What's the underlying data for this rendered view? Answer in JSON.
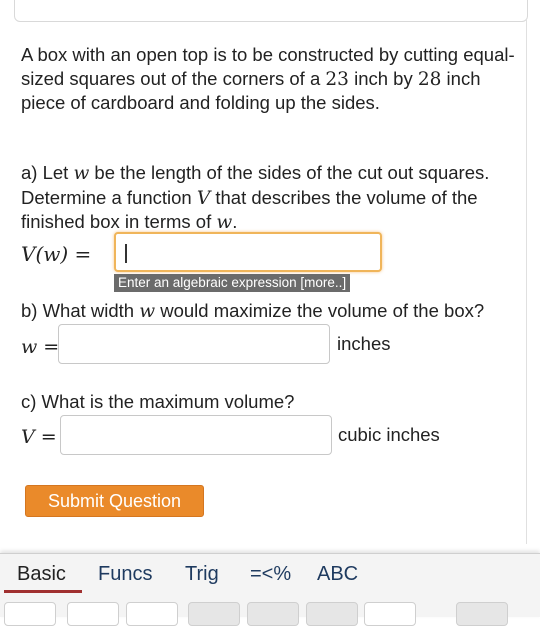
{
  "problem": {
    "intro_text": "A box with an open top is to be constructed by cutting equal-sized squares out of the corners of a ",
    "dim1": "23",
    "intro_mid": " inch by ",
    "dim2": "28",
    "intro_end": " inch piece of cardboard and folding up the sides."
  },
  "part_a": {
    "text1": "a) Let ",
    "var_w": "w",
    "text2": " be the length of the sides of the cut out squares. Determine a function ",
    "var_V": "V",
    "text3": " that describes the volume of the finished box in terms of ",
    "var_w2": "w",
    "text4": ".",
    "function_label": "V(w) =",
    "input_value": "",
    "hint": "Enter an algebraic expression [more..]"
  },
  "part_b": {
    "text1": "b) What width ",
    "var_w": "w",
    "text2": " would maximize the volume of the box?",
    "label": "w =",
    "input_value": "",
    "unit": "inches"
  },
  "part_c": {
    "question": "c) What is the maximum volume?",
    "label": "V =",
    "input_value": "",
    "unit": "cubic inches"
  },
  "submit_label": "Submit Question",
  "keyboard": {
    "tabs": [
      "Basic",
      "Funcs",
      "Trig",
      "=<%",
      "ABC"
    ],
    "active_tab": "Basic"
  },
  "colors": {
    "accent": "#ea8a2a",
    "focus_border": "#f0b55a",
    "tab_active_underline": "#a03030"
  }
}
